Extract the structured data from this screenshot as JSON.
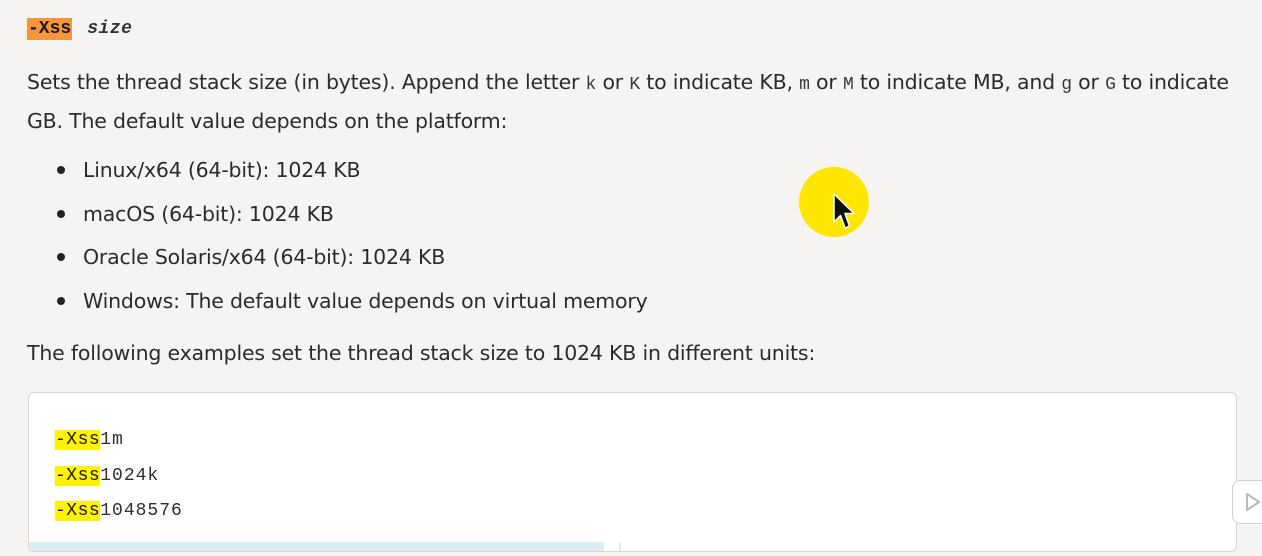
{
  "heading": {
    "option": "-Xss",
    "param": "size"
  },
  "description": {
    "part1": "Sets the thread stack size (in bytes). Append the letter ",
    "k_lower": "k",
    "or1": " or ",
    "k_upper": "K",
    "part2": " to indicate KB, ",
    "m_lower": "m",
    "or2": " or ",
    "m_upper": "M",
    "part3": " to indicate MB, and ",
    "g_lower": "g",
    "or3": " or ",
    "g_upper": "G",
    "part4": " to indicate GB. The default value depends on the platform:"
  },
  "platforms": [
    "Linux/x64 (64-bit): 1024 KB",
    "macOS (64-bit): 1024 KB",
    "Oracle Solaris/x64 (64-bit): 1024 KB",
    "Windows: The default value depends on virtual memory"
  ],
  "examples_intro": "The following examples set the thread stack size to 1024 KB in different units:",
  "examples": [
    {
      "flag": "-Xss",
      "value": "1m"
    },
    {
      "flag": "-Xss",
      "value": "1024k"
    },
    {
      "flag": "-Xss",
      "value": "1048576"
    }
  ],
  "colors": {
    "heading_highlight": "#f7953a",
    "search_highlight": "#fff200",
    "cursor_halo": "#ffe600"
  },
  "icons": {
    "cursor": "mouse-pointer-icon",
    "side_button": "play-icon"
  }
}
